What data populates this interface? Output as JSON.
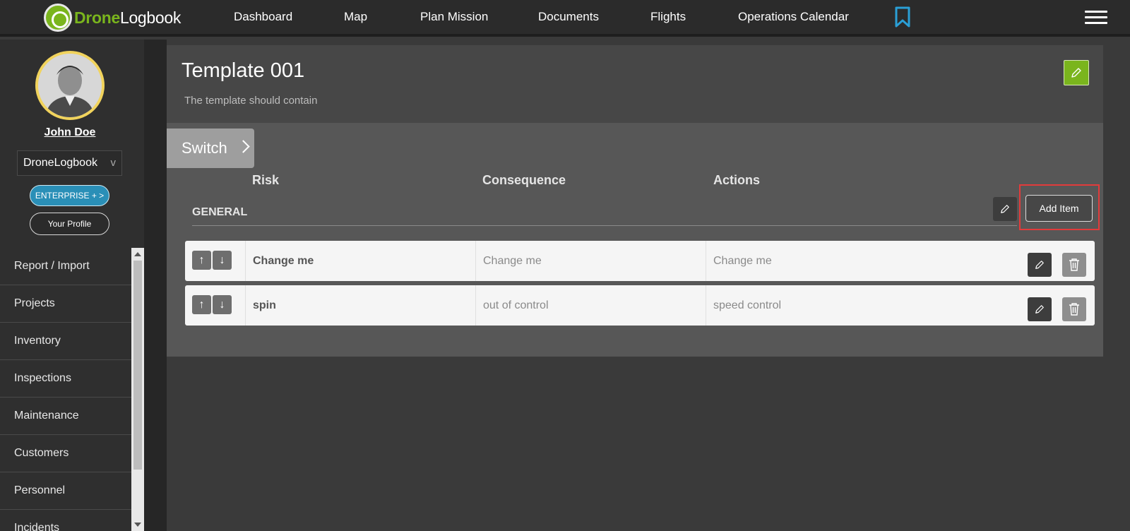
{
  "app": {
    "logo_part1": "Drone",
    "logo_part2": "Logbook"
  },
  "nav": {
    "items": [
      {
        "label": "Dashboard"
      },
      {
        "label": "Map"
      },
      {
        "label": "Plan Mission"
      },
      {
        "label": "Documents"
      },
      {
        "label": "Flights"
      },
      {
        "label": "Operations Calendar"
      }
    ],
    "bookmark_icon": "bookmark-icon",
    "menu_icon": "hamburger-menu-icon"
  },
  "sidebar": {
    "user_name": "John Doe",
    "org": "DroneLogbook",
    "org_chevron": "v",
    "enterprise_label": "ENTERPRISE + >",
    "profile_label": "Your Profile",
    "menu": [
      {
        "label": "Report / Import"
      },
      {
        "label": "Projects"
      },
      {
        "label": "Inventory"
      },
      {
        "label": "Inspections"
      },
      {
        "label": "Maintenance"
      },
      {
        "label": "Customers"
      },
      {
        "label": "Personnel"
      },
      {
        "label": "Incidents"
      }
    ]
  },
  "template": {
    "title": "Template 001",
    "description": "The template should contain",
    "switch_label": "Switch",
    "columns": {
      "risk": "Risk",
      "consequence": "Consequence",
      "actions": "Actions"
    },
    "section_title": "GENERAL",
    "add_item_label": "Add Item",
    "rows": [
      {
        "risk": "Change me",
        "consequence": "Change me",
        "actions": "Change me"
      },
      {
        "risk": "spin",
        "consequence": "out of control",
        "actions": "speed control"
      }
    ]
  },
  "colors": {
    "brand_green": "#7ab51d",
    "enterprise_blue": "#2a8fb7",
    "highlight_red": "#e23b3b"
  }
}
